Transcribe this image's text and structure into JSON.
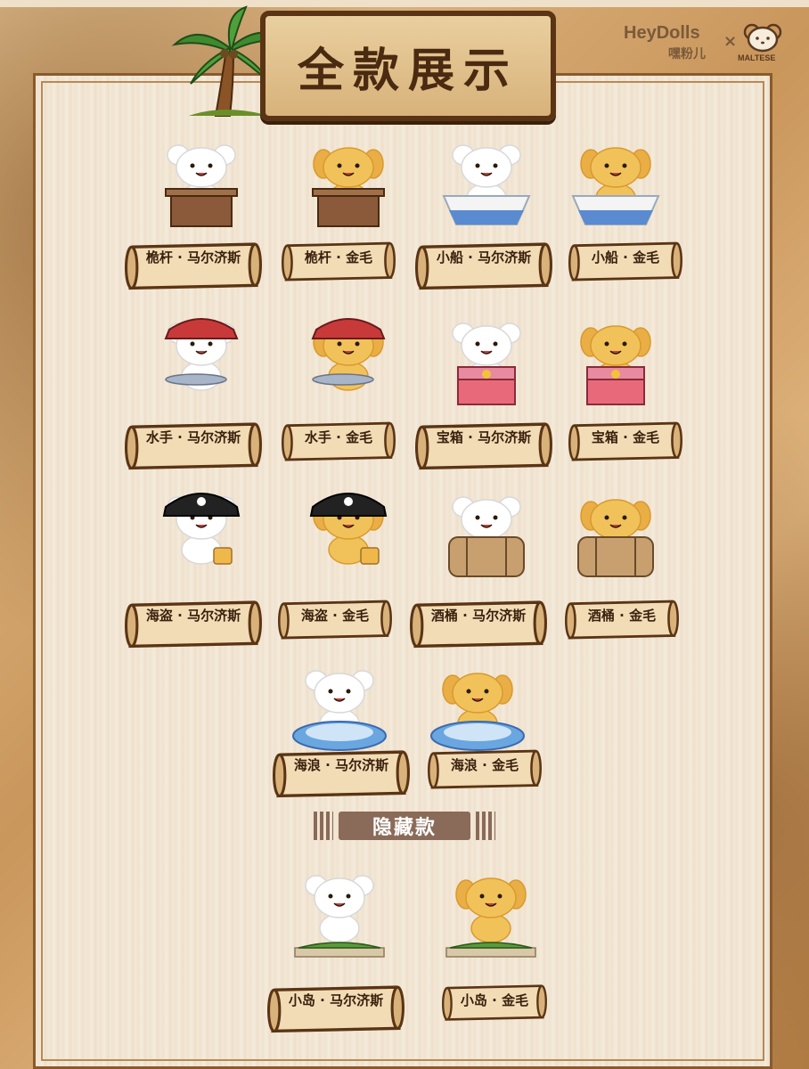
{
  "title": "全款展示",
  "brand": {
    "heydolls": "HeyDolls",
    "heydolls_cn": "嘿粉儿",
    "cross": "×",
    "maltese": "MALTESE"
  },
  "hidden_label": "隐藏款",
  "colors": {
    "frame": "#5a3414",
    "text": "#3a200d",
    "white_dog": "#ffffff",
    "golden_dog": "#f2c25a"
  },
  "items": [
    {
      "label": "桅杆 · 马尔济斯",
      "dog": "white",
      "prop": "mast"
    },
    {
      "label": "桅杆 · 金毛",
      "dog": "golden",
      "prop": "mast"
    },
    {
      "label": "小船 · 马尔济斯",
      "dog": "white",
      "prop": "boat"
    },
    {
      "label": "小船 · 金毛",
      "dog": "golden",
      "prop": "boat"
    },
    {
      "label": "水手 · 马尔济斯",
      "dog": "white",
      "prop": "sailor"
    },
    {
      "label": "水手 · 金毛",
      "dog": "golden",
      "prop": "sailor"
    },
    {
      "label": "宝箱 · 马尔济斯",
      "dog": "white",
      "prop": "chest"
    },
    {
      "label": "宝箱 · 金毛",
      "dog": "golden",
      "prop": "chest"
    },
    {
      "label": "海盗 · 马尔济斯",
      "dog": "white",
      "prop": "pirate"
    },
    {
      "label": "海盗 · 金毛",
      "dog": "golden",
      "prop": "pirate"
    },
    {
      "label": "酒桶 · 马尔济斯",
      "dog": "white",
      "prop": "barrel"
    },
    {
      "label": "酒桶 · 金毛",
      "dog": "golden",
      "prop": "barrel"
    },
    {
      "label": "海浪 · 马尔济斯",
      "dog": "white",
      "prop": "wave"
    },
    {
      "label": "海浪 · 金毛",
      "dog": "golden",
      "prop": "wave"
    },
    {
      "label": "小岛 · 马尔济斯",
      "dog": "white",
      "prop": "island"
    },
    {
      "label": "小岛 · 金毛",
      "dog": "golden",
      "prop": "island"
    }
  ]
}
